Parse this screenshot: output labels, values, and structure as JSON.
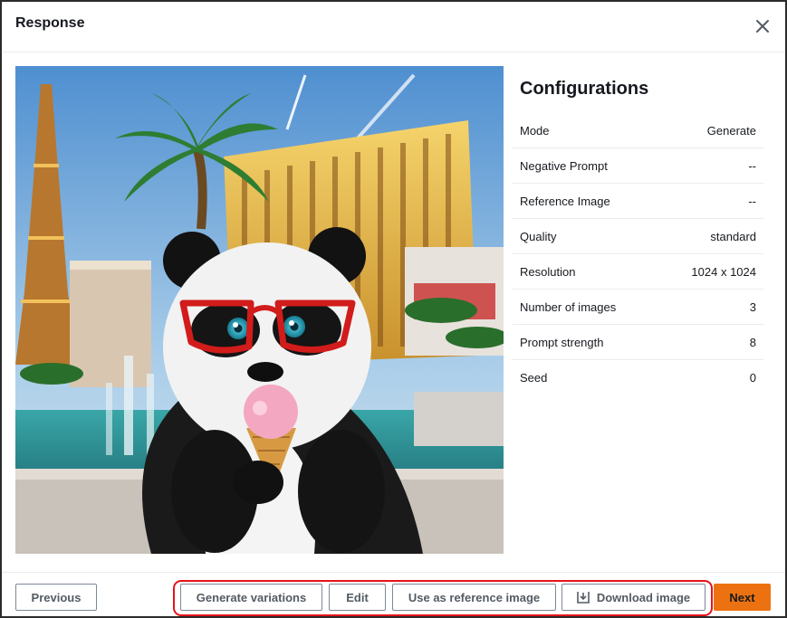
{
  "modal": {
    "title": "Response",
    "close_icon": "close-icon"
  },
  "image": {
    "alt": "Panda with red glasses eating ice cream in Las Vegas"
  },
  "configurations": {
    "heading": "Configurations",
    "rows": [
      {
        "label": "Mode",
        "value": "Generate"
      },
      {
        "label": "Negative Prompt",
        "value": "--"
      },
      {
        "label": "Reference Image",
        "value": "--"
      },
      {
        "label": "Quality",
        "value": "standard"
      },
      {
        "label": "Resolution",
        "value": "1024 x 1024"
      },
      {
        "label": "Number of images",
        "value": "3"
      },
      {
        "label": "Prompt strength",
        "value": "8"
      },
      {
        "label": "Seed",
        "value": "0"
      }
    ]
  },
  "footer": {
    "previous_label": "Previous",
    "generate_variations_label": "Generate variations",
    "edit_label": "Edit",
    "use_reference_label": "Use as reference image",
    "download_label": "Download image",
    "download_icon": "download-icon",
    "next_label": "Next"
  },
  "colors": {
    "primary_button": "#ec7211",
    "highlight_outline": "#e4141b",
    "border": "#e9ebed"
  }
}
